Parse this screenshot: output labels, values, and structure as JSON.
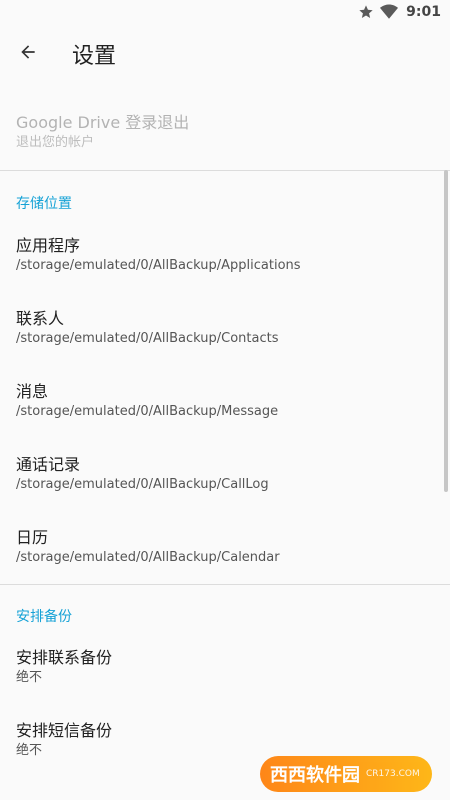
{
  "status_bar": {
    "time": "9:01",
    "icons": [
      "star-icon",
      "wifi-icon"
    ]
  },
  "toolbar": {
    "title": "设置",
    "back_icon": "arrow-back-icon"
  },
  "account": {
    "title": "Google Drive 登录退出",
    "subtitle": "退出您的帐户"
  },
  "storage_section": {
    "header": "存储位置",
    "items": [
      {
        "title": "应用程序",
        "path": "/storage/emulated/0/AllBackup/Applications"
      },
      {
        "title": "联系人",
        "path": "/storage/emulated/0/AllBackup/Contacts"
      },
      {
        "title": "消息",
        "path": "/storage/emulated/0/AllBackup/Message"
      },
      {
        "title": "通话记录",
        "path": "/storage/emulated/0/AllBackup/CallLog"
      },
      {
        "title": "日历",
        "path": "/storage/emulated/0/AllBackup/Calendar"
      }
    ]
  },
  "schedule_section": {
    "header": "安排备份",
    "items": [
      {
        "title": "安排联系备份",
        "value": "绝不"
      },
      {
        "title": "安排短信备份",
        "value": "绝不"
      }
    ]
  },
  "watermark": {
    "text": "西西软件园",
    "small": "CR173.COM"
  },
  "colors": {
    "accent": "#16a2d6",
    "background": "#fafafa"
  }
}
